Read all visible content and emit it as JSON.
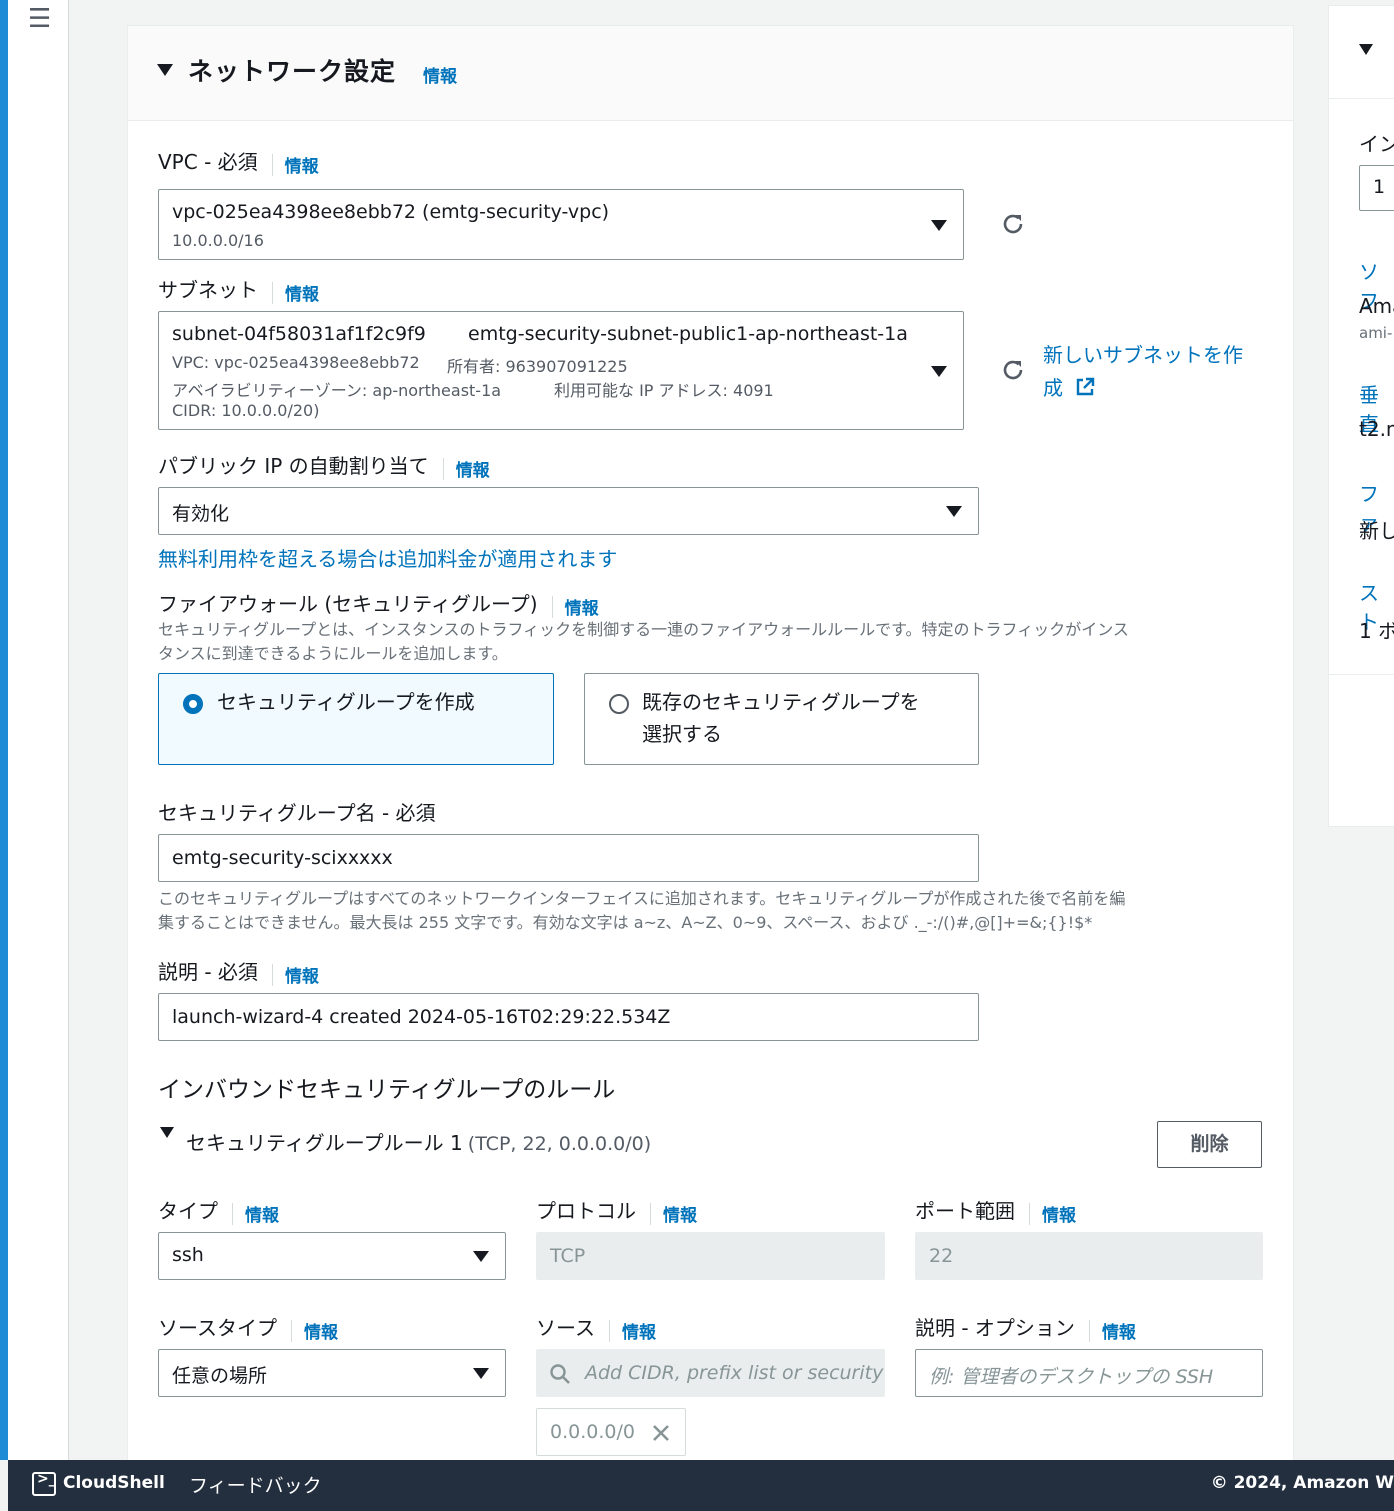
{
  "nav": {
    "menu_icon": "☰"
  },
  "panel": {
    "title": "ネットワーク設定",
    "info": "情報"
  },
  "vpc": {
    "label": "VPC - 必須",
    "info": "情報",
    "value": "vpc-025ea4398ee8ebb72 (emtg-security-vpc)",
    "cidr": "10.0.0.0/16"
  },
  "subnet": {
    "label": "サブネット",
    "info": "情報",
    "id": "subnet-04f58031af1f2c9f9",
    "name": "emtg-security-subnet-public1-ap-northeast-1a",
    "vpc_line": "VPC: vpc-025ea4398ee8ebb72",
    "owner_line": "所有者: 963907091225",
    "az_line": "アベイラビリティーゾーン: ap-northeast-1a",
    "ip_line": "利用可能な IP アドレス: 4091",
    "cidr_line": "CIDR: 10.0.0.0/20)",
    "create_link_1": "新しいサブネットを作",
    "create_link_2": "成"
  },
  "public_ip": {
    "label": "パブリック IP の自動割り当て",
    "info": "情報",
    "value": "有効化",
    "notice": "無料利用枠を超える場合は追加料金が適用されます"
  },
  "firewall": {
    "label": "ファイアウォール (セキュリティグループ)",
    "info": "情報",
    "description_1": "セキュリティグループとは、インスタンスのトラフィックを制御する一連のファイアウォールルールです。特定のトラフィックがインス",
    "description_2": "タンスに到達できるようにルールを追加します。",
    "option_create": "セキュリティグループを作成",
    "option_existing_1": "既存のセキュリティグループを",
    "option_existing_2": "選択する"
  },
  "sg_name": {
    "label": "セキュリティグループ名 - 必須",
    "value": "emtg-security-scixxxxx",
    "hint_1": "このセキュリティグループはすべてのネットワークインターフェイスに追加されます。セキュリティグループが作成された後で名前を編",
    "hint_2": "集することはできません。最大長は 255 文字です。有効な文字は a~z、A~Z、0~9、スペース、および ._-:/()#,@[]+=&;{}!$*"
  },
  "sg_desc": {
    "label": "説明 - 必須",
    "info": "情報",
    "value": "launch-wizard-4 created 2024-05-16T02:29:22.534Z"
  },
  "inbound": {
    "title": "インバウンドセキュリティグループのルール",
    "rule_title": "セキュリティグループルール 1",
    "rule_meta": "(TCP, 22, 0.0.0.0/0)",
    "delete_label": "削除",
    "type_label": "タイプ",
    "type_value": "ssh",
    "protocol_label": "プロトコル",
    "protocol_value": "TCP",
    "port_label": "ポート範囲",
    "port_value": "22",
    "source_type_label": "ソースタイプ",
    "source_type_value": "任意の場所",
    "source_label": "ソース",
    "source_placeholder": "Add CIDR, prefix list or security",
    "source_token": "0.0.0.0/0",
    "desc_label": "説明 - オプション",
    "desc_placeholder": "例: 管理者のデスクトップの SSH",
    "info": "情報"
  },
  "right": {
    "frag_1": "イン",
    "frag_2": "1",
    "frag_3": "ソフ",
    "frag_4": "Ama",
    "frag_5": "ami-",
    "frag_6": "垂直",
    "frag_7": "t2.n",
    "frag_8": "ファ",
    "frag_9": "新し",
    "frag_10": "スト",
    "frag_11": "1 ボ"
  },
  "footer": {
    "cloudshell": "CloudShell",
    "feedback": "フィードバック",
    "copyright": "© 2024, Amazon W"
  },
  "colors": {
    "accent": "#0073bb",
    "footer_bg": "#232f3e",
    "border": "#879596"
  }
}
